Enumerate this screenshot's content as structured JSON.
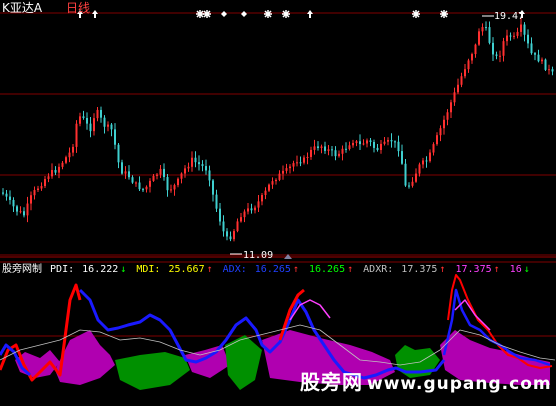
{
  "header": {
    "title": "K亚达A",
    "period": "日线"
  },
  "price_labels": {
    "high": "19.47",
    "low": "11.09"
  },
  "indicator": {
    "name": "股旁网制",
    "items": [
      {
        "label": "PDI:",
        "value": "16.222",
        "arrow": "↓",
        "color": "#ffffff"
      },
      {
        "label": "MDI:",
        "value": "25.667",
        "arrow": "↑",
        "color": "#ffff00"
      },
      {
        "label": "ADX:",
        "value": "16.265",
        "arrow": "↑",
        "color": "#2040ff"
      },
      {
        "label": "",
        "value": "16.265",
        "arrow": "↑",
        "color": "#00ff00"
      },
      {
        "label": "ADXR:",
        "value": "17.375",
        "arrow": "↑",
        "color": "#c0c0c0"
      },
      {
        "label": "",
        "value": "17.375",
        "arrow": "↑",
        "color": "#ff40ff"
      },
      {
        "label": "",
        "value": "16",
        "arrow": "↓",
        "color": "#ff40ff"
      }
    ]
  },
  "watermark": {
    "text": "股旁网",
    "url": "www.gupang.com"
  },
  "colors": {
    "up": "#ff3030",
    "down": "#3fd0d0",
    "grid": "#800000",
    "red_line": "#ff0000",
    "blue_line": "#1a1aff",
    "magenta_line": "#ff40ff",
    "green_fill": "#009000",
    "magenta_fill": "#b000b0"
  },
  "icons": [
    "diamond-marker-icon",
    "arrow-up-marker-icon"
  ]
}
